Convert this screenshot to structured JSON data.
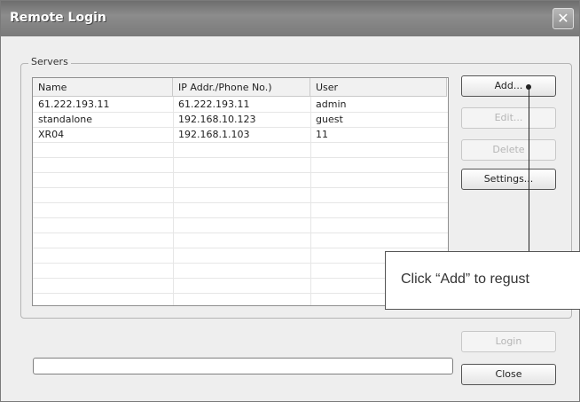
{
  "window": {
    "title": "Remote Login",
    "close_glyph": "✕"
  },
  "servers": {
    "group_label": "Servers",
    "columns": [
      "Name",
      "IP Addr./Phone No.)",
      "User"
    ],
    "rows": [
      [
        "61.222.193.11",
        "61.222.193.11",
        "admin"
      ],
      [
        "standalone",
        "192.168.10.123",
        "guest"
      ],
      [
        "XR04",
        "192.168.1.103",
        "11"
      ]
    ]
  },
  "buttons": {
    "add": "Add...",
    "edit": "Edit...",
    "delete": "Delete",
    "settings": "Settings...",
    "login": "Login",
    "close": "Close"
  },
  "callout": {
    "text": "Click “Add” to regust"
  },
  "icons": {
    "close": "close-icon"
  }
}
